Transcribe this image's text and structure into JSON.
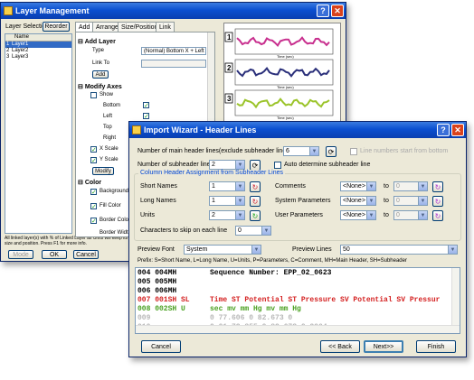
{
  "layer_window": {
    "title": "Layer Management",
    "layer_selection_label": "Layer Selection",
    "reorder_label": "Reorder",
    "tabs": [
      "Add",
      "Arrange",
      "Size/Position",
      "Link"
    ],
    "list_header": "Name",
    "layers": [
      {
        "index": "1",
        "name": "Layer1"
      },
      {
        "index": "2",
        "name": "Layer2"
      },
      {
        "index": "3",
        "name": "Layer3"
      }
    ],
    "add_layer": {
      "section": "Add Layer",
      "type_label": "Type",
      "type_value": "(Normal) Bottom X + Left Y",
      "link_to_label": "Link To",
      "add_button": "Add"
    },
    "modify_axes": {
      "section": "Modify Axes",
      "show_label": "Show",
      "bottom": "Bottom",
      "left": "Left",
      "top": "Top",
      "right": "Right",
      "x_scale": "X Scale",
      "y_scale": "Y Scale",
      "modify_button": "Modify"
    },
    "color": {
      "section": "Color",
      "background": "Background Co",
      "fill": "Fill Color",
      "border": "Border Color",
      "border_width": "Border Width"
    },
    "status_text": "All linked layer(s) with % of Linked Layer as Units will keep its size and position. Press F1 for more info.",
    "mode_label": "Mode",
    "ok_label": "OK",
    "cancel_label": "Cancel",
    "graph_markers": [
      "1",
      "2",
      "3"
    ],
    "graph_axis_titles": [
      "Time (sec)",
      "Time (sec)",
      "Time (sec)"
    ],
    "series_colors": [
      "#c82f8e",
      "#2a2f7a",
      "#9bc42a"
    ]
  },
  "import_window": {
    "title": "Import Wizard - Header Lines",
    "main_header_label": "Number of main header lines(exclude subheader lines)",
    "main_header_value": "6",
    "line_numbers_label": "Line numbers start from bottom",
    "subheader_label": "Number of subheader lines",
    "subheader_value": "2",
    "auto_determine_label": "Auto determine subheader line",
    "group_title": "Column Header Assignment from Subheader Lines",
    "left_rows": [
      {
        "label": "Short Names",
        "value": "1"
      },
      {
        "label": "Long Names",
        "value": "1"
      },
      {
        "label": "Units",
        "value": "2"
      }
    ],
    "right_rows": [
      {
        "label": "Comments",
        "value": "<None>",
        "to": "to",
        "to_value": "0"
      },
      {
        "label": "System Parameters",
        "value": "<None>",
        "to": "to",
        "to_value": "0"
      },
      {
        "label": "User Parameters",
        "value": "<None>",
        "to": "to",
        "to_value": "0"
      }
    ],
    "skip_label": "Characters to skip on each line",
    "skip_value": "0",
    "preview_font_label": "Preview Font",
    "preview_font_value": "System",
    "preview_lines_label": "Preview Lines",
    "preview_lines_value": "50",
    "prefix_legend": "Prefix:  S=Short Name, L=Long Name, U=Units, P=Parameters, C=Comment, MH=Main Header, SH=Subheader",
    "preview_lines": [
      {
        "prefix": "004 004MH",
        "text": "Sequence Number: EPP_02_0623",
        "color": "#000000"
      },
      {
        "prefix": "005 005MH",
        "text": "",
        "color": "#000000"
      },
      {
        "prefix": "006 006MH",
        "text": "",
        "color": "#000000"
      },
      {
        "prefix": "007 001SH SL",
        "text": "Time ST Potential ST Pressure SV Potential SV Pressur",
        "color": "#d42020"
      },
      {
        "prefix": "008 002SH  U",
        "text": "sec mv mm Hg mv mm Hg",
        "color": "#49a020"
      },
      {
        "prefix": "009",
        "text": "0 77.606 0 82.673 0",
        "color": "#b8b8b8"
      },
      {
        "prefix": "010",
        "text": "0.01 72.355 0 82.673 0.2964",
        "color": "#b8b8b8"
      }
    ],
    "cancel_label": "Cancel",
    "back_label": "<< Back",
    "next_label": "Next>>",
    "finish_label": "Finish"
  }
}
